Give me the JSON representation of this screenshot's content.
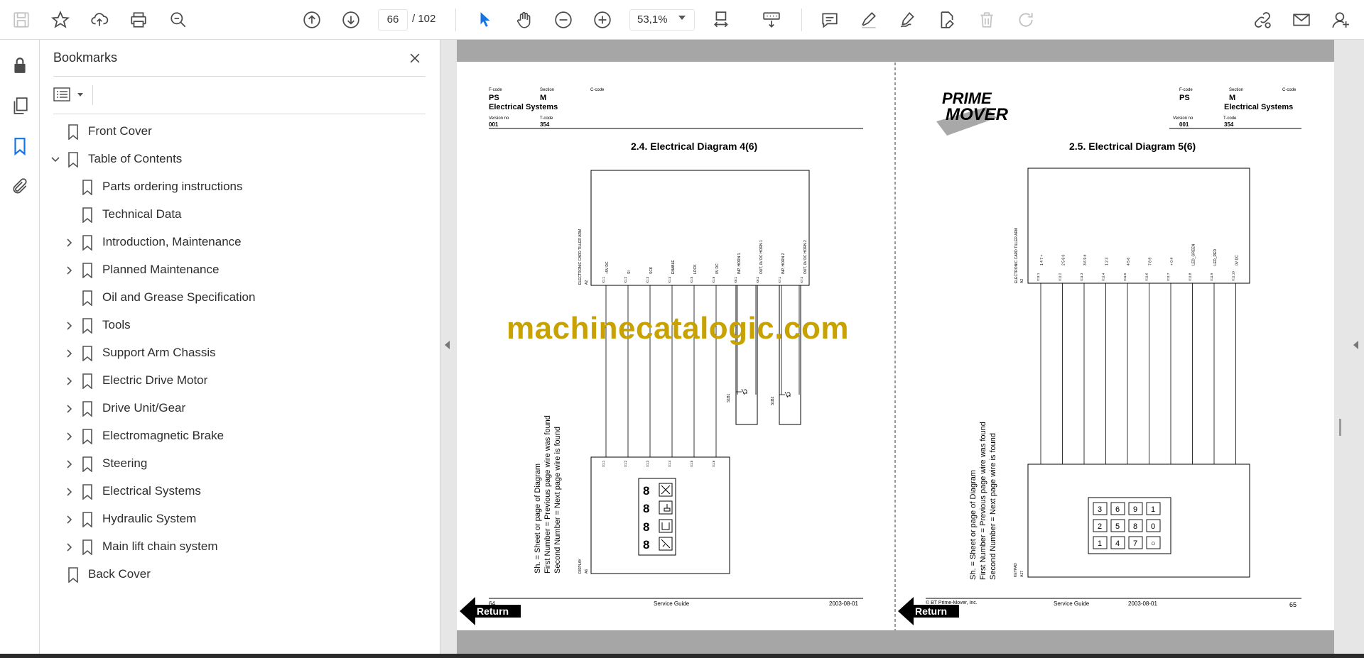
{
  "toolbar": {
    "page_current": "66",
    "page_total": "/ 102",
    "zoom": "53,1%",
    "icons": [
      "save-icon",
      "star-icon",
      "upload-icon",
      "print-icon",
      "zoom-search-icon",
      "page-up-icon",
      "page-down-icon",
      "select-cursor-icon",
      "hand-icon",
      "zoom-out-icon",
      "zoom-in-icon",
      "fit-page-icon",
      "scroll-mode-icon",
      "comment-icon",
      "highlight-icon",
      "sign-icon",
      "edit-pdf-icon",
      "delete-icon",
      "redo-icon",
      "share-link-icon",
      "email-icon",
      "account-icon"
    ]
  },
  "rail": {
    "icons": [
      "lock-icon",
      "pages-icon",
      "bookmark-icon",
      "attachment-icon"
    ]
  },
  "bookmarks": {
    "title": "Bookmarks",
    "items": [
      {
        "label": "Front Cover",
        "level": 0,
        "caret": "none"
      },
      {
        "label": "Table of Contents",
        "level": 0,
        "caret": "down"
      },
      {
        "label": "Parts ordering instructions",
        "level": 1,
        "caret": "none"
      },
      {
        "label": "Technical Data",
        "level": 1,
        "caret": "none"
      },
      {
        "label": "Introduction, Maintenance",
        "level": 1,
        "caret": "right"
      },
      {
        "label": "Planned Maintenance",
        "level": 1,
        "caret": "right"
      },
      {
        "label": "Oil and Grease Specification",
        "level": 1,
        "caret": "none"
      },
      {
        "label": "Tools",
        "level": 1,
        "caret": "right"
      },
      {
        "label": "Support Arm Chassis",
        "level": 1,
        "caret": "right"
      },
      {
        "label": "Electric Drive Motor",
        "level": 1,
        "caret": "right"
      },
      {
        "label": "Drive Unit/Gear",
        "level": 1,
        "caret": "right"
      },
      {
        "label": "Electromagnetic Brake",
        "level": 1,
        "caret": "right"
      },
      {
        "label": "Steering",
        "level": 1,
        "caret": "right"
      },
      {
        "label": "Electrical Systems",
        "level": 1,
        "caret": "right"
      },
      {
        "label": "Hydraulic System",
        "level": 1,
        "caret": "right"
      },
      {
        "label": "Main lift chain system",
        "level": 1,
        "caret": "right"
      },
      {
        "label": "Back Cover",
        "level": 0,
        "caret": "none"
      }
    ]
  },
  "watermark": "machinecatalogic.com",
  "left_page": {
    "hdr_fcode_label": "F-code",
    "hdr_section_label": "Section",
    "hdr_ccode_label": "C-code",
    "fcode": "PS",
    "section": "M",
    "section_name": "Electrical Systems",
    "version_label": "Version no",
    "tcode_label": "T-code",
    "version": "001",
    "tcode": "354",
    "title": "2.4. Electrical Diagram 4(6)",
    "connector_label": "ELECTRONIC CARD TILLER ARM",
    "connector_ref": "A2",
    "pins": [
      "X1:1",
      "X1:2",
      "X1:3",
      "X1:4",
      "X1:5",
      "X1:6",
      "X6:1",
      "X6:2",
      "X7:1",
      "X7:2"
    ],
    "signals": [
      "+5V DC",
      "SI",
      "SCK",
      "ENABLE",
      "LOCK",
      "0V DC",
      "INP, HORN 1",
      "OUT, 0V DC HORN 1",
      "INP, HORN 2",
      "OUT, 0V DC HORN 2"
    ],
    "switch1": "S1B1",
    "switch2": "S1B2",
    "display_pins": [
      "X1:1",
      "X1:2",
      "X1:3",
      "X1:4",
      "X1:5",
      "X1:6"
    ],
    "display_label": "DISPLAY",
    "display_ref": "A6",
    "legend_line1": "Sh. = Sheet or page of Diagram",
    "legend_line2": "First Number = Previous page wire was found",
    "legend_line3": "Second Number = Next page wire is found",
    "page_no": "64",
    "footer_center": "Service Guide",
    "footer_date": "2003-08-01",
    "return_label": "Return"
  },
  "right_page": {
    "logo_line1": "PRIME",
    "logo_line2": "MOVER",
    "hdr_fcode_label": "F-code",
    "hdr_section_label": "Section",
    "hdr_ccode_label": "C-code",
    "fcode": "PS",
    "section": "M",
    "section_name": "Electrical Systems",
    "version_label": "Version no",
    "tcode_label": "T-code",
    "version": "001",
    "tcode": "354",
    "title": "2.5. Electrical Diagram 5(6)",
    "connector_label": "ELECTRONIC CARD TILLER ARM",
    "connector_ref": "A2",
    "pins": [
      "X11:1",
      "X11:2",
      "X11:3",
      "X11:4",
      "X11:5",
      "X11:6",
      "X11:7",
      "X11:8",
      "X11:9",
      "X11:10"
    ],
    "signals": [
      "1 4 7 +",
      "2 5 8 0",
      "3 6 9 #",
      "1 2 3",
      "4 5 6",
      "7 8 9",
      "+ 0 #",
      "LED_GREEN",
      "LED_RED",
      "0V DC"
    ],
    "keypad_keys": [
      "3",
      "6",
      "9",
      "1",
      "2",
      "5",
      "8",
      "0",
      "1",
      "4",
      "7",
      "○"
    ],
    "keypad_label": "KEYPAD",
    "keypad_ref": "A17",
    "legend_line1": "Sh. = Sheet or page of Diagram",
    "legend_line2": "First Number = Previous page wire was found",
    "legend_line3": "Second Number = Next page wire is found",
    "copyright": "© BT Prime-Mover, Inc.",
    "footer_center": "Service Guide",
    "footer_date": "2003-08-01",
    "page_no": "65",
    "return_label": "Return"
  }
}
